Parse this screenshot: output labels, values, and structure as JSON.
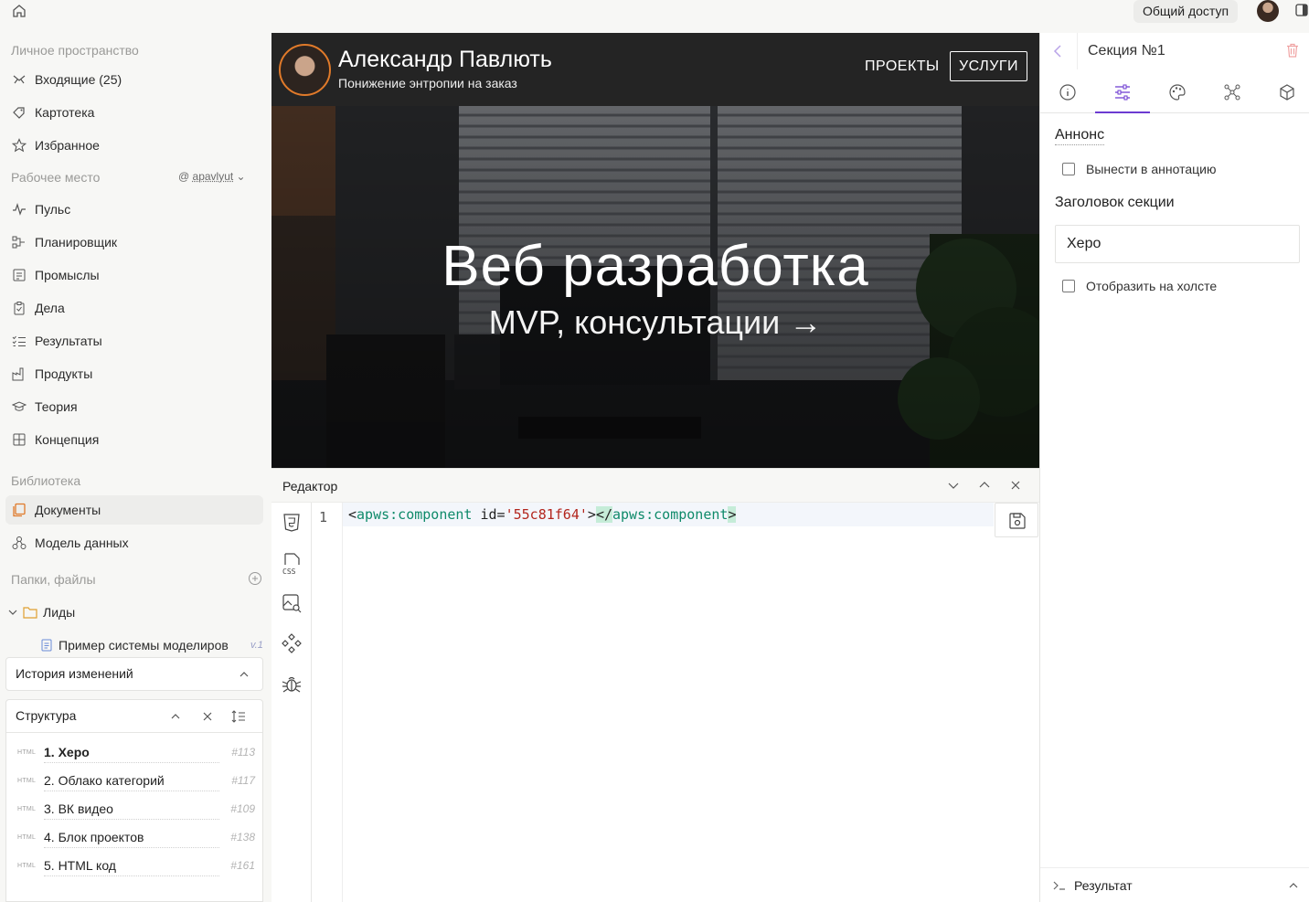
{
  "topbar": {
    "share_label": "Общий доступ"
  },
  "sidebar": {
    "personal_label": "Личное пространство",
    "personal_items": [
      {
        "label": "Входящие (25)",
        "icon": "inbox-icon"
      },
      {
        "label": "Картотека",
        "icon": "tag-icon"
      },
      {
        "label": "Избранное",
        "icon": "star-icon"
      }
    ],
    "workspace_label": "Рабочее место",
    "workspace_user": "apavlyut",
    "workspace_items": [
      {
        "label": "Пульс",
        "icon": "pulse-icon"
      },
      {
        "label": "Планировщик",
        "icon": "planner-icon"
      },
      {
        "label": "Промыслы",
        "icon": "crafts-icon"
      },
      {
        "label": "Дела",
        "icon": "clipboard-icon"
      },
      {
        "label": "Результаты",
        "icon": "checklist-icon"
      },
      {
        "label": "Продукты",
        "icon": "factory-icon"
      },
      {
        "label": "Теория",
        "icon": "graduation-icon"
      },
      {
        "label": "Концепция",
        "icon": "concept-icon"
      }
    ],
    "library_label": "Библиотека",
    "library_items": [
      {
        "label": "Документы",
        "icon": "documents-icon"
      },
      {
        "label": "Модель данных",
        "icon": "data-model-icon"
      }
    ],
    "folders_label": "Папки, файлы",
    "folder_name": "Лиды",
    "file_name": "Пример системы моделиров",
    "file_version": "v.1",
    "history_label": "История изменений",
    "structure_label": "Структура",
    "structure_items": [
      {
        "tag": "HTML",
        "name": "1. Xepo",
        "num": "#113"
      },
      {
        "tag": "HTML",
        "name": "2. Облако категорий",
        "num": "#117"
      },
      {
        "tag": "HTML",
        "name": "3. ВК видео",
        "num": "#109"
      },
      {
        "tag": "HTML",
        "name": "4. Блок проектов",
        "num": "#138"
      },
      {
        "tag": "HTML",
        "name": "5. HTML код",
        "num": "#161"
      }
    ]
  },
  "preview": {
    "name": "Александр Павлють",
    "tagline": "Понижение энтропии на заказ",
    "nav_projects": "ПРОЕКТЫ",
    "nav_services": "УСЛУГИ",
    "hero_title": "Веб разработка",
    "hero_subtitle": "MVP, консультации →"
  },
  "editor": {
    "title": "Редактор",
    "line_number": "1",
    "code": {
      "open_bracket": "<",
      "tag": "apws:component",
      "attr": " id=",
      "value": "'55c81f64'",
      "close_open": ">",
      "end_open": "</",
      "end_tag": "apws:component",
      "end_close": ">"
    },
    "tools": [
      "html5-icon",
      "css-icon",
      "image-search-icon",
      "components-icon",
      "bug-icon"
    ]
  },
  "right_panel": {
    "title": "Секция №1",
    "tabs": [
      "info-icon",
      "sliders-icon",
      "palette-icon",
      "nodes-icon",
      "box-icon"
    ],
    "announce_label": "Аннонс",
    "announce_checkbox": "Вынести в аннотацию",
    "section_title_label": "Заголовок секции",
    "section_title_value": "Xepo",
    "canvas_checkbox": "Отобразить на холсте",
    "result_label": "Результат"
  },
  "colors": {
    "accent": "#6c3bd1",
    "avatar_ring": "#e07a2a",
    "code_tag": "#0f8a6a",
    "code_string": "#b3261e"
  }
}
